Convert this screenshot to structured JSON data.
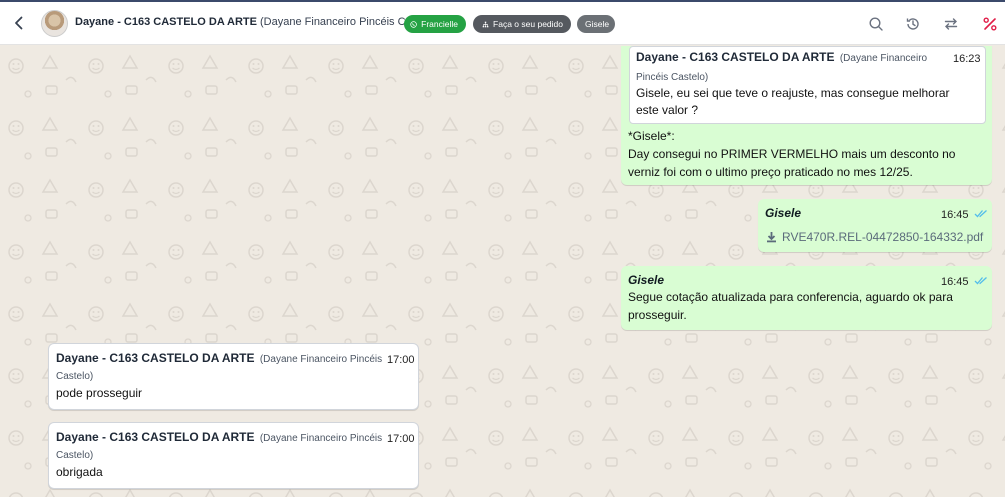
{
  "header": {
    "contact_name": "Dayane - C163 CASTELO DA ARTE",
    "contact_sub": "(Dayane Financeiro Pincéis Castelo)",
    "tags": {
      "whatsapp": "Francielle",
      "order": "Faça o seu pedido",
      "agent": "Gisele"
    },
    "icons": [
      "back-arrow-icon",
      "search-icon",
      "history-icon",
      "transfer-icon",
      "percent-icon"
    ],
    "colors": {
      "tag_green": "#25a244",
      "percent_icon": "#e11d48",
      "outgoing_bubble": "#d9fdd3"
    }
  },
  "messages": {
    "m1": {
      "quote_sender": "Dayane - C163 CASTELO DA ARTE",
      "quote_sub_1": "(Dayane Financeiro",
      "quote_sub_2": "Pincéis Castelo)",
      "quote_time": "16:23",
      "quote_text_1": "Gisele, eu sei que teve o reajuste, mas consegue melhorar",
      "quote_text_2": "este valor ?",
      "reply_line_1": "*Gisele*:",
      "reply_line_2": "Day consegui no PRIMER VERMELHO mais um desconto no",
      "reply_line_3": "verniz foi com o ultimo preço praticado no mes 12/25."
    },
    "m2": {
      "sender": "Gisele",
      "time": "16:45",
      "file_name": "RVE470R.REL-04472850-164332.pdf"
    },
    "m3": {
      "sender": "Gisele",
      "time": "16:45",
      "text_1": "Segue cotação atualizada para conferencia, aguardo ok para",
      "text_2": "prosseguir."
    },
    "m4": {
      "sender": "Dayane - C163 CASTELO DA ARTE",
      "sub_1": "(Dayane Financeiro Pincéis",
      "sub_2": "Castelo)",
      "time": "17:00",
      "text": "pode prosseguir"
    },
    "m5": {
      "sender": "Dayane - C163 CASTELO DA ARTE",
      "sub_1": "(Dayane Financeiro Pincéis",
      "sub_2": "Castelo)",
      "time": "17:00",
      "text": "obrigada"
    }
  }
}
